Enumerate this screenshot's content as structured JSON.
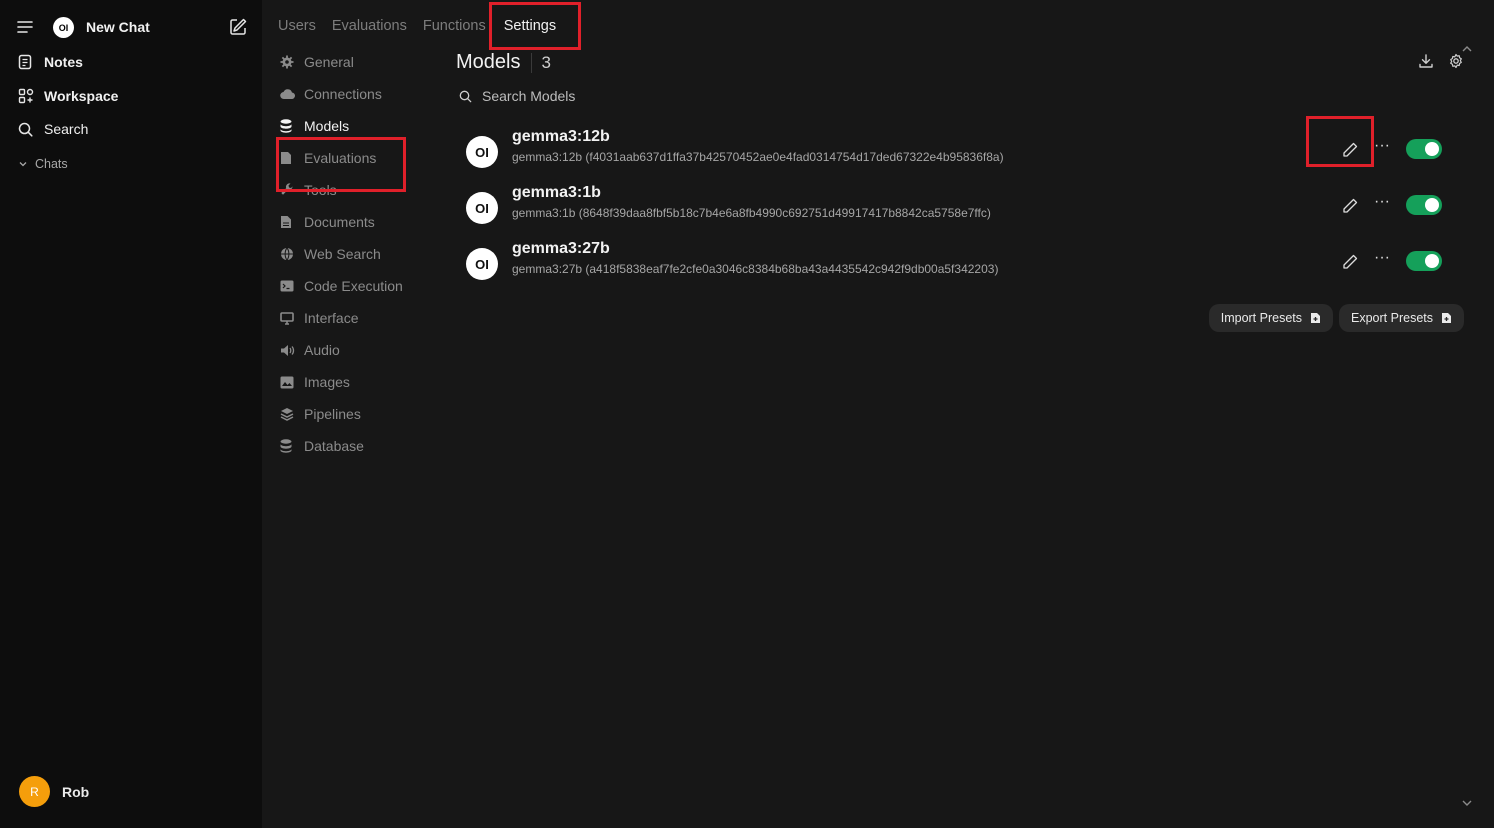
{
  "sidebar": {
    "new_chat_label": "New Chat",
    "logo_text": "OI",
    "items": [
      {
        "label": "Notes",
        "icon": "notes-icon"
      },
      {
        "label": "Workspace",
        "icon": "workspace-icon"
      },
      {
        "label": "Search",
        "icon": "search-icon"
      }
    ],
    "chats_label": "Chats",
    "user": {
      "initial": "R",
      "name": "Rob",
      "avatar_color": "#f59e0b"
    }
  },
  "tabs": [
    "Users",
    "Evaluations",
    "Functions",
    "Settings"
  ],
  "active_tab": "Settings",
  "settings_nav": [
    {
      "label": "General",
      "icon": "gear-icon"
    },
    {
      "label": "Connections",
      "icon": "cloud-icon"
    },
    {
      "label": "Models",
      "icon": "stack-icon"
    },
    {
      "label": "Evaluations",
      "icon": "document-icon"
    },
    {
      "label": "Tools",
      "icon": "wrench-icon"
    },
    {
      "label": "Documents",
      "icon": "file-icon"
    },
    {
      "label": "Web Search",
      "icon": "globe-icon"
    },
    {
      "label": "Code Execution",
      "icon": "terminal-icon"
    },
    {
      "label": "Interface",
      "icon": "monitor-icon"
    },
    {
      "label": "Audio",
      "icon": "speaker-icon"
    },
    {
      "label": "Images",
      "icon": "image-icon"
    },
    {
      "label": "Pipelines",
      "icon": "layers-icon"
    },
    {
      "label": "Database",
      "icon": "database-icon"
    }
  ],
  "models_panel": {
    "title": "Models",
    "count": "3",
    "search_placeholder": "Search Models",
    "models": [
      {
        "name": "gemma3:12b",
        "desc": "gemma3:12b (f4031aab637d1ffa37b42570452ae0e4fad0314754d17ded67322e4b95836f8a)",
        "enabled": true
      },
      {
        "name": "gemma3:1b",
        "desc": "gemma3:1b (8648f39daa8fbf5b18c7b4e6a8fb4990c692751d49917417b8842ca5758e7ffc)",
        "enabled": true
      },
      {
        "name": "gemma3:27b",
        "desc": "gemma3:27b (a418f5838eaf7fe2cfe0a3046c8384b68ba43a4435542c942f9db00a5f342203)",
        "enabled": true
      }
    ],
    "import_label": "Import Presets",
    "export_label": "Export Presets",
    "more_label": "···"
  },
  "colors": {
    "highlight": "#e0202a",
    "toggle_on": "#15a05a",
    "sidebar_bg": "#0d0d0d",
    "main_bg": "#171717"
  }
}
